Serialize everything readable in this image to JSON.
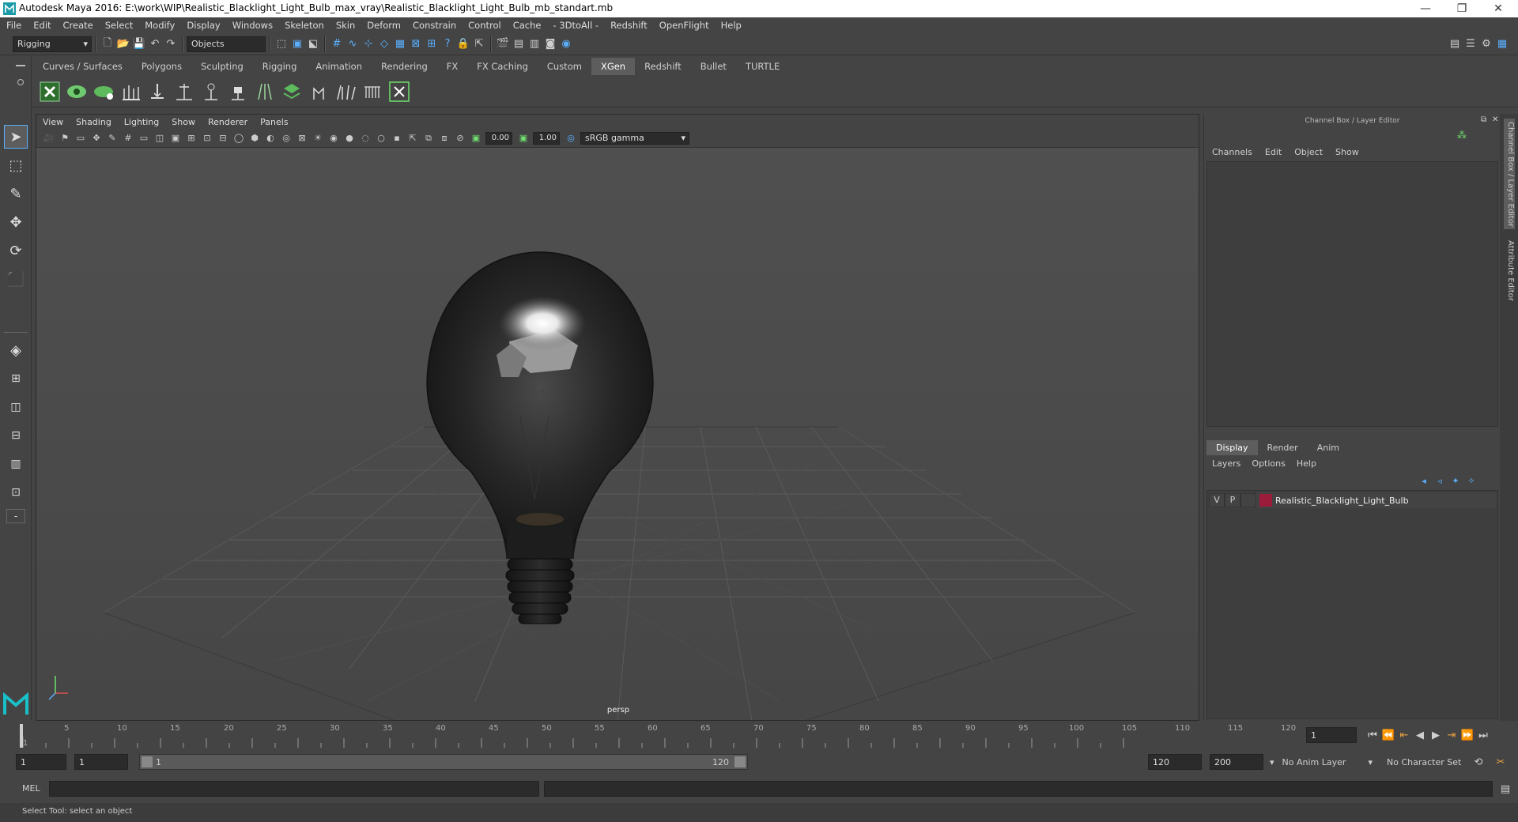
{
  "window": {
    "title": "Autodesk Maya 2016: E:\\work\\WIP\\Realistic_Blacklight_Light_Bulb_max_vray\\Realistic_Blacklight_Light_Bulb_mb_standart.mb",
    "minimize": "—",
    "restore": "❐",
    "close": "✕"
  },
  "menubar": [
    "File",
    "Edit",
    "Create",
    "Select",
    "Modify",
    "Display",
    "Windows",
    "Skeleton",
    "Skin",
    "Deform",
    "Constrain",
    "Control",
    "Cache",
    "- 3DtoAll -",
    "Redshift",
    "OpenFlight",
    "Help"
  ],
  "statusline": {
    "menuset": "Rigging",
    "selection_mode": "Objects"
  },
  "shelf": {
    "tabs": [
      "Curves / Surfaces",
      "Polygons",
      "Sculpting",
      "Rigging",
      "Animation",
      "Rendering",
      "FX",
      "FX Caching",
      "Custom",
      "XGen",
      "Redshift",
      "Bullet",
      "TURTLE"
    ],
    "active": "XGen"
  },
  "viewport": {
    "menu": [
      "View",
      "Shading",
      "Lighting",
      "Show",
      "Renderer",
      "Panels"
    ],
    "exposure": "0.00",
    "gamma": "1.00",
    "colorspace": "sRGB gamma",
    "camera": "persp"
  },
  "channelbox": {
    "title": "Channel Box / Layer Editor",
    "menu": [
      "Channels",
      "Edit",
      "Object",
      "Show"
    ],
    "layer_tabs": [
      "Display",
      "Render",
      "Anim"
    ],
    "layer_tab_active": "Display",
    "layer_menu": [
      "Layers",
      "Options",
      "Help"
    ],
    "layer": {
      "v": "V",
      "p": "P",
      "name": "Realistic_Blacklight_Light_Bulb",
      "color": "#9b1b3b"
    }
  },
  "sidetabs": [
    "Channel Box / Layer Editor",
    "Attribute Editor"
  ],
  "timeline": {
    "ticks": [
      "1",
      "5",
      "10",
      "15",
      "20",
      "25",
      "30",
      "35",
      "40",
      "45",
      "50",
      "55",
      "60",
      "65",
      "70",
      "75",
      "80",
      "85",
      "90",
      "95",
      "100",
      "105",
      "110",
      "115",
      "120"
    ],
    "current_frame": "1"
  },
  "range": {
    "start": "1",
    "playback_start": "1",
    "slider_start": "1",
    "slider_end": "120",
    "playback_end": "120",
    "end": "200",
    "anim_layer": "No Anim Layer",
    "char_set": "No Character Set"
  },
  "cmdline": {
    "lang": "MEL"
  },
  "helpline": {
    "text": "Select Tool: select an object"
  },
  "colors": {
    "accent": "#5ab0ff",
    "panel": "#444444",
    "field": "#2b2b2b"
  }
}
